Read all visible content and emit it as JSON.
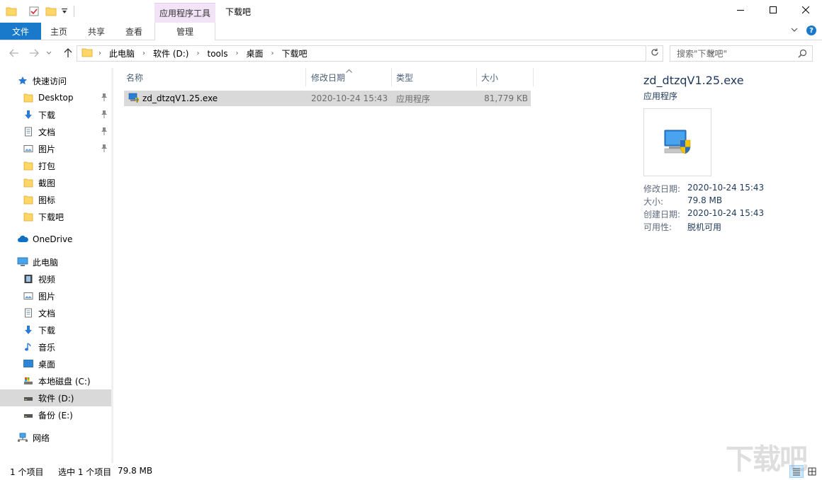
{
  "window": {
    "title": "下载吧",
    "context_tab_group": "应用程序工具"
  },
  "ribbon": {
    "tabs": [
      {
        "label": "文件"
      },
      {
        "label": "主页"
      },
      {
        "label": "共享"
      },
      {
        "label": "查看"
      },
      {
        "label": "管理"
      }
    ],
    "help_glyph": "?"
  },
  "address": {
    "breadcrumbs": [
      "此电脑",
      "软件 (D:)",
      "tools",
      "桌面",
      "下载吧"
    ],
    "search_placeholder": "搜索\"下载吧\""
  },
  "nav": {
    "quick_access": "快速访问",
    "quick_items": [
      {
        "label": "Desktop",
        "icon": "folder-icon",
        "pinned": true
      },
      {
        "label": "下载",
        "icon": "download-icon",
        "pinned": true
      },
      {
        "label": "文档",
        "icon": "document-icon",
        "pinned": true
      },
      {
        "label": "图片",
        "icon": "picture-icon",
        "pinned": true
      },
      {
        "label": "打包",
        "icon": "folder-icon",
        "pinned": false
      },
      {
        "label": "截图",
        "icon": "folder-icon",
        "pinned": false
      },
      {
        "label": "图标",
        "icon": "folder-icon",
        "pinned": false
      },
      {
        "label": "下载吧",
        "icon": "folder-icon",
        "pinned": false
      }
    ],
    "onedrive": "OneDrive",
    "this_pc": "此电脑",
    "pc_items": [
      {
        "label": "视频",
        "icon": "video-icon"
      },
      {
        "label": "图片",
        "icon": "picture-icon"
      },
      {
        "label": "文档",
        "icon": "document-icon"
      },
      {
        "label": "下载",
        "icon": "download-icon"
      },
      {
        "label": "音乐",
        "icon": "music-icon"
      },
      {
        "label": "桌面",
        "icon": "desktop-icon"
      },
      {
        "label": "本地磁盘 (C:)",
        "icon": "system-drive-icon"
      },
      {
        "label": "软件 (D:)",
        "icon": "drive-icon",
        "selected": true
      },
      {
        "label": "备份 (E:)",
        "icon": "drive-icon"
      }
    ],
    "network": "网络"
  },
  "columns": {
    "name": "名称",
    "date": "修改日期",
    "type": "类型",
    "size": "大小"
  },
  "files": [
    {
      "name": "zd_dtzqV1.25.exe",
      "date": "2020-10-24 15:43",
      "type": "应用程序",
      "size": "81,779 KB",
      "selected": true
    }
  ],
  "details": {
    "name": "zd_dtzqV1.25.exe",
    "type": "应用程序",
    "props": [
      {
        "key": "修改日期:",
        "value": "2020-10-24 15:43"
      },
      {
        "key": "大小:",
        "value": "79.8 MB"
      },
      {
        "key": "创建日期:",
        "value": "2020-10-24 15:43"
      },
      {
        "key": "可用性:",
        "value": "脱机可用"
      }
    ]
  },
  "status": {
    "count": "1 个项目",
    "selection": "选中 1 个项目",
    "size": "79.8 MB"
  },
  "watermark": "下载吧",
  "colors": {
    "accent": "#1979ca",
    "context_tab": "#f2e3f7",
    "selection": "#d9d9d9",
    "folder": "#ffd766"
  }
}
